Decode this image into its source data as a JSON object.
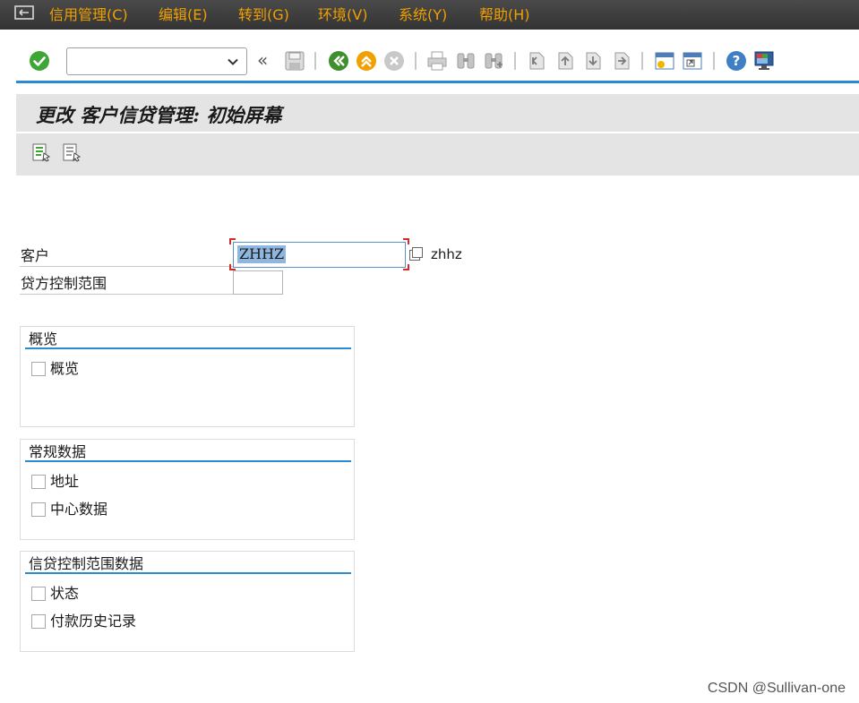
{
  "menu": {
    "items": [
      {
        "label": "信用管理(C)"
      },
      {
        "label": "编辑(E)"
      },
      {
        "label": "转到(G)"
      },
      {
        "label": "环境(V)"
      },
      {
        "label": "系统(Y)"
      },
      {
        "label": "帮助(H)"
      }
    ]
  },
  "toolbar": {
    "command_field_value": "",
    "back_chevrons": "«",
    "icons": [
      "enter-check-icon",
      "save-icon",
      "back-icon",
      "exit-icon",
      "cancel-icon",
      "print-icon",
      "find-icon",
      "find-next-icon",
      "first-page-icon",
      "previous-page-icon",
      "next-page-icon",
      "last-page-icon",
      "new-session-icon",
      "shortcut-icon",
      "help-icon",
      "layout-icon"
    ]
  },
  "title": "更改 客户信贷管理: 初始屏幕",
  "app_toolbar": {
    "icons": [
      "select-all-icon",
      "deselect-all-icon"
    ]
  },
  "form": {
    "customer_label": "客户",
    "customer_value": "ZHHZ",
    "customer_desc": "zhhz",
    "credit_area_label": "贷方控制范围",
    "credit_area_value": ""
  },
  "groups": {
    "overview": {
      "title": "概览",
      "checkboxes": [
        {
          "label": "概览",
          "checked": false
        }
      ]
    },
    "general": {
      "title": "常规数据",
      "checkboxes": [
        {
          "label": "地址",
          "checked": false
        },
        {
          "label": "中心数据",
          "checked": false
        }
      ]
    },
    "credit_area_data": {
      "title": "信贷控制范围数据",
      "checkboxes": [
        {
          "label": "状态",
          "checked": false
        },
        {
          "label": "付款历史记录",
          "checked": false
        }
      ]
    }
  },
  "watermark": "CSDN @Sullivan-one",
  "colors": {
    "menu_bg": "#3b3b3b",
    "menu_text": "#f0a000",
    "accent": "#2b8bd0",
    "title_bg": "#e4e4e4",
    "selection": "#8fb6de"
  }
}
